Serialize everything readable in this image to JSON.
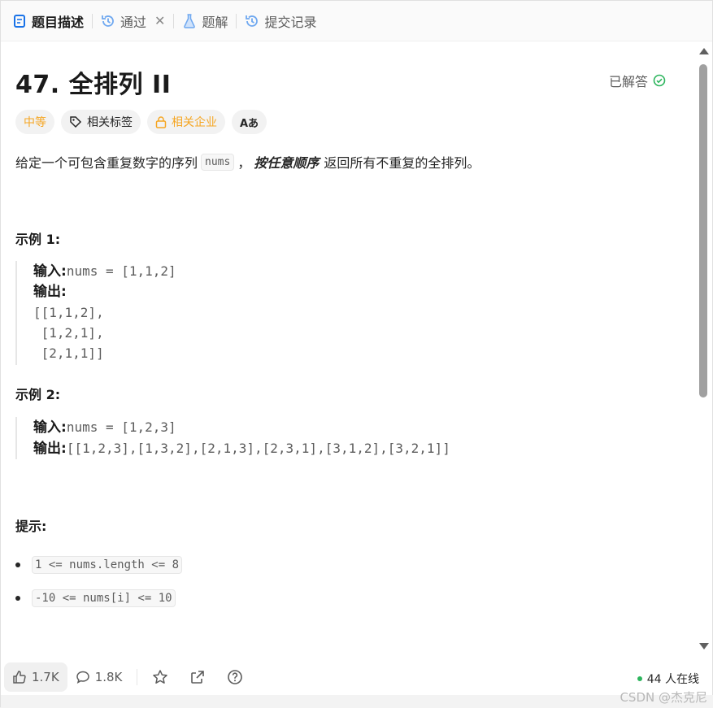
{
  "tabs": [
    {
      "label": "题目描述",
      "icon": "document-icon"
    },
    {
      "label": "通过",
      "icon": "history-icon"
    },
    {
      "label": "题解",
      "icon": "flask-icon"
    },
    {
      "label": "提交记录",
      "icon": "history-icon"
    }
  ],
  "problem": {
    "title": "47. 全排列 II",
    "status": "已解答",
    "tags": {
      "difficulty": "中等",
      "related_tags": "相关标签",
      "related_companies": "相关企业",
      "translate": "Aあ"
    },
    "desc_prefix": "给定一个可包含重复数字的序列",
    "desc_code": "nums",
    "desc_comma": "，",
    "desc_emphasis": "按任意顺序",
    "desc_suffix": "返回所有不重复的全排列。"
  },
  "example1": {
    "heading": "示例 1:",
    "input_label": "输入:",
    "input_value": "nums = [1,1,2]",
    "output_label": "输出:",
    "output_lines": [
      "[[1,1,2],",
      " [1,2,1],",
      " [2,1,1]]"
    ]
  },
  "example2": {
    "heading": "示例 2:",
    "input_label": "输入:",
    "input_value": "nums = [1,2,3]",
    "output_label": "输出:",
    "output_value": "[[1,2,3],[1,3,2],[2,1,3],[2,3,1],[3,1,2],[3,2,1]]"
  },
  "hints": {
    "heading": "提示:",
    "items": [
      "1 <= nums.length <= 8",
      "-10 <= nums[i] <= 10"
    ]
  },
  "footer": {
    "likes": "1.7K",
    "comments": "1.8K",
    "online": "44 人在线"
  },
  "watermark": "CSDN @杰克尼",
  "colors": {
    "accent_blue": "#1a73e8",
    "difficulty_orange": "#f5a623",
    "solved_green": "#2db55d"
  }
}
